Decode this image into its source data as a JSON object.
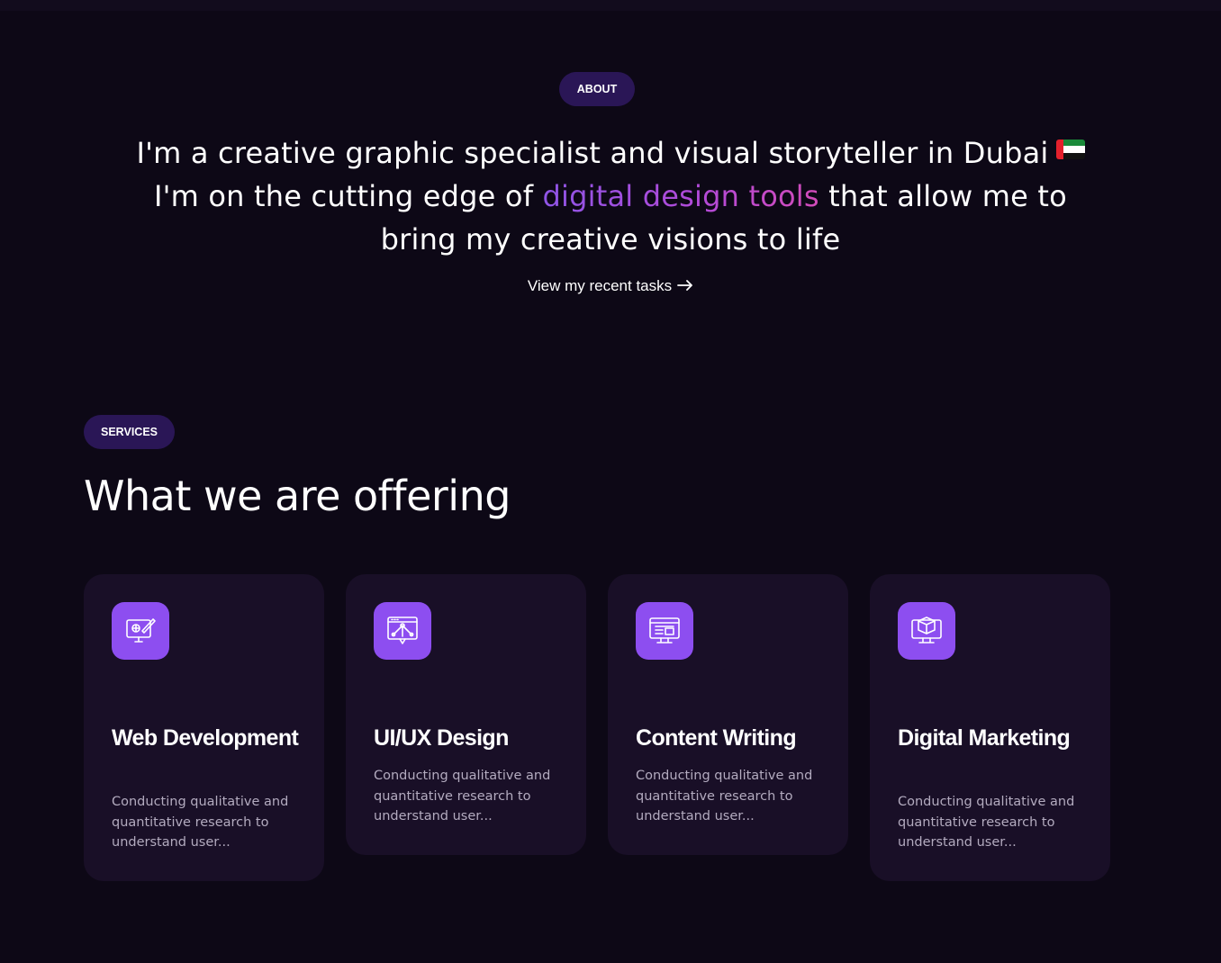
{
  "about": {
    "badge": "ABOUT",
    "line1": "I'm a creative graphic specialist and visual storyteller in Dubai",
    "flag_icon": "uae-flag-icon",
    "line2_before": "I'm on the cutting edge of ",
    "line2_highlight": "digital design tools",
    "line2_after": " that allow me to",
    "line3": "bring my creative visions to life",
    "link_label": "View my recent tasks",
    "link_icon": "arrow-right-icon",
    "highlight_colors": [
      "#8f55e6",
      "#d24bb9"
    ]
  },
  "services": {
    "badge": "SERVICES",
    "title": "What we are offering",
    "cards": [
      {
        "icon": "web-design-monitor-icon",
        "title": "Web Development",
        "description": "Conducting qualitative and quantitative research to understand user..."
      },
      {
        "icon": "ui-ux-design-icon",
        "title": "UI/UX Design",
        "description": "Conducting qualitative and quantitative research to understand user..."
      },
      {
        "icon": "content-writing-monitor-icon",
        "title": "Content Writing",
        "description": "Conducting qualitative and quantitative research to understand user..."
      },
      {
        "icon": "digital-marketing-cube-icon",
        "title": "Digital Marketing",
        "description": "Conducting qualitative and quantitative research to understand user..."
      }
    ]
  },
  "colors": {
    "background": "#0d0816",
    "card": "#190f27",
    "badge": "#2a1656",
    "accent": "#8d4ef0",
    "muted_text": "#b3abbf"
  }
}
